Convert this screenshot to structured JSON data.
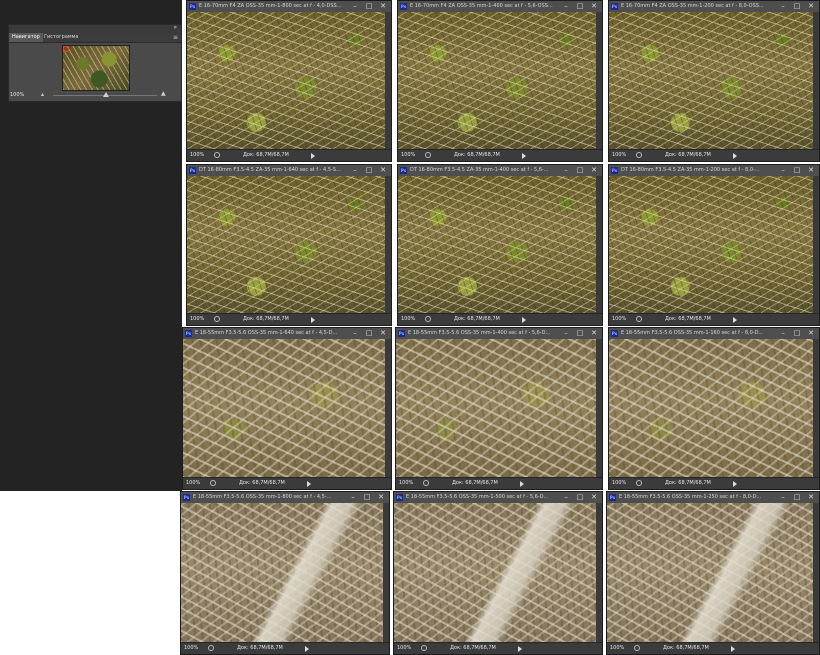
{
  "navigator": {
    "tabs": [
      "Навигатор",
      "Гистограмма"
    ],
    "zoom": "100%",
    "collapse_icon": "double-chevron-icon",
    "menu_icon": "panel-menu-icon"
  },
  "docs": [
    {
      "title": "E 16-70mm F4 ZA OSS-35 mm-1-800 sec at f - 4,0-DSS...",
      "zoom": "100%",
      "doc": "Док: 68,7M/68,7M"
    },
    {
      "title": "E 16-70mm F4 ZA OSS-35 mm-1-400 sec at f - 5,6-OSS...",
      "zoom": "100%",
      "doc": "Док: 68,7M/68,7M"
    },
    {
      "title": "E 16-70mm F4 ZA OSS-35 mm-1-200 sec at f - 8,0-OSS...",
      "zoom": "100%",
      "doc": "Док: 68,7M/68,7M"
    },
    {
      "title": "DT 16-80mm F3.5-4.5 ZA-35 mm-1-640 sec at f - 4,5-S...",
      "zoom": "100%",
      "doc": "Док: 68,7M/68,7M"
    },
    {
      "title": "DT 16-80mm F3.5-4.5 ZA-35 mm-1-400 sec at f - 5,6-...",
      "zoom": "100%",
      "doc": "Док: 68,7M/68,7M"
    },
    {
      "title": "DT 16-80mm F3.5-4.5 ZA-35 mm-1-200 sec at f - 8,0-...",
      "zoom": "100%",
      "doc": "Док: 68,7M/68,7M"
    },
    {
      "title": "E 18-55mm F3.5-5.6 OSS-35 mm-1-640 sec at f - 4,5-D...",
      "zoom": "100%",
      "doc": "Док: 68,7M/68,7M"
    },
    {
      "title": "E 18-55mm F3.5-5.6 OSS-35 mm-1-400 sec at f - 5,6-D...",
      "zoom": "100%",
      "doc": "Док: 68,7M/68,7M"
    },
    {
      "title": "E 18-55mm F3.5-5.6 OSS-35 mm-1-160 sec at f - 8,0-D...",
      "zoom": "100%",
      "doc": "Док: 68,7M/68,7M"
    },
    {
      "title": "E 18-55mm F3.5-5.6 OSS-35 mm-1-800 sec at f - 4,5-...",
      "zoom": "100%",
      "doc": "Док: 68,7M/68,7M"
    },
    {
      "title": "E 18-55mm F3.5-5.6 OSS-35 mm-1-500 sec at f - 5,6-D...",
      "zoom": "100%",
      "doc": "Док: 68,7M/68,7M"
    },
    {
      "title": "E 18-55mm F3.5-5.6 OSS-35 mm-1-250 sec at f - 8,0-D...",
      "zoom": "100%",
      "doc": "Док: 68,7M/68,7M"
    }
  ],
  "window_icons": {
    "minimize": "minimize-icon",
    "maximize": "maximize-icon",
    "close": "close-icon",
    "app": "photoshop-icon"
  }
}
